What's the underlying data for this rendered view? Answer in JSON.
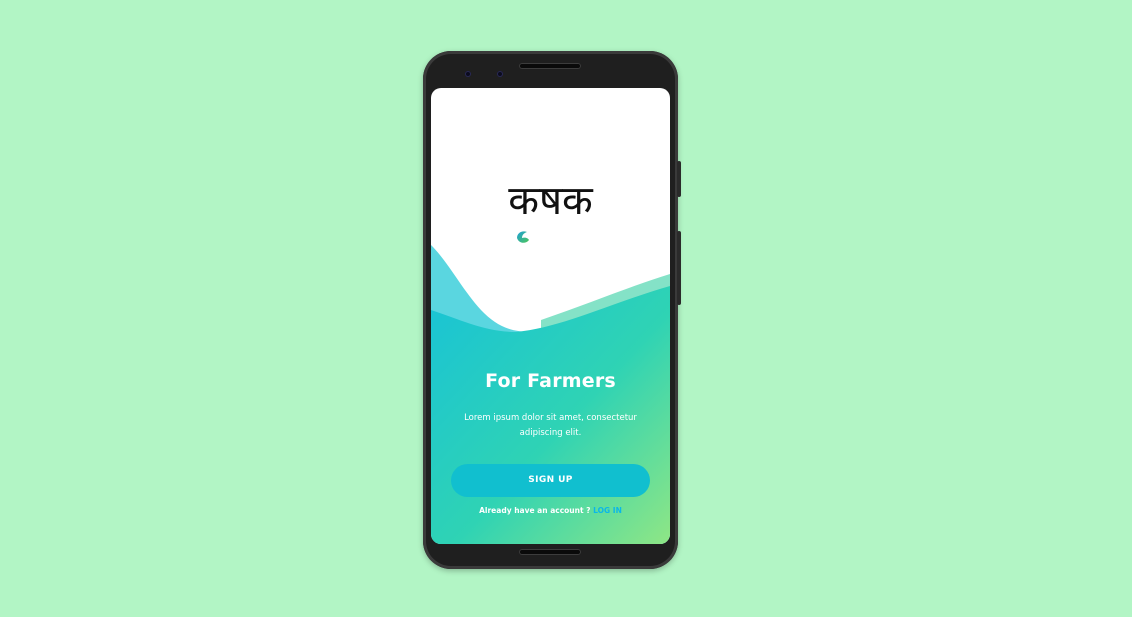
{
  "app": {
    "logo_text": "कषक",
    "logo_mark_icon": "leaf-icon"
  },
  "hero": {
    "title": "For Farmers",
    "subtitle": "Lorem ipsum dolor sit amet, consectetur adipiscing elit."
  },
  "actions": {
    "signup_label": "SIGN UP",
    "account_prompt": "Already have an account ?",
    "login_label": "LOG IN"
  },
  "colors": {
    "background": "#b2f5c5",
    "gradient_start": "#19c3d6",
    "gradient_end": "#8fe685",
    "button": "#11bfcf",
    "login_link": "#0ab7e8"
  }
}
